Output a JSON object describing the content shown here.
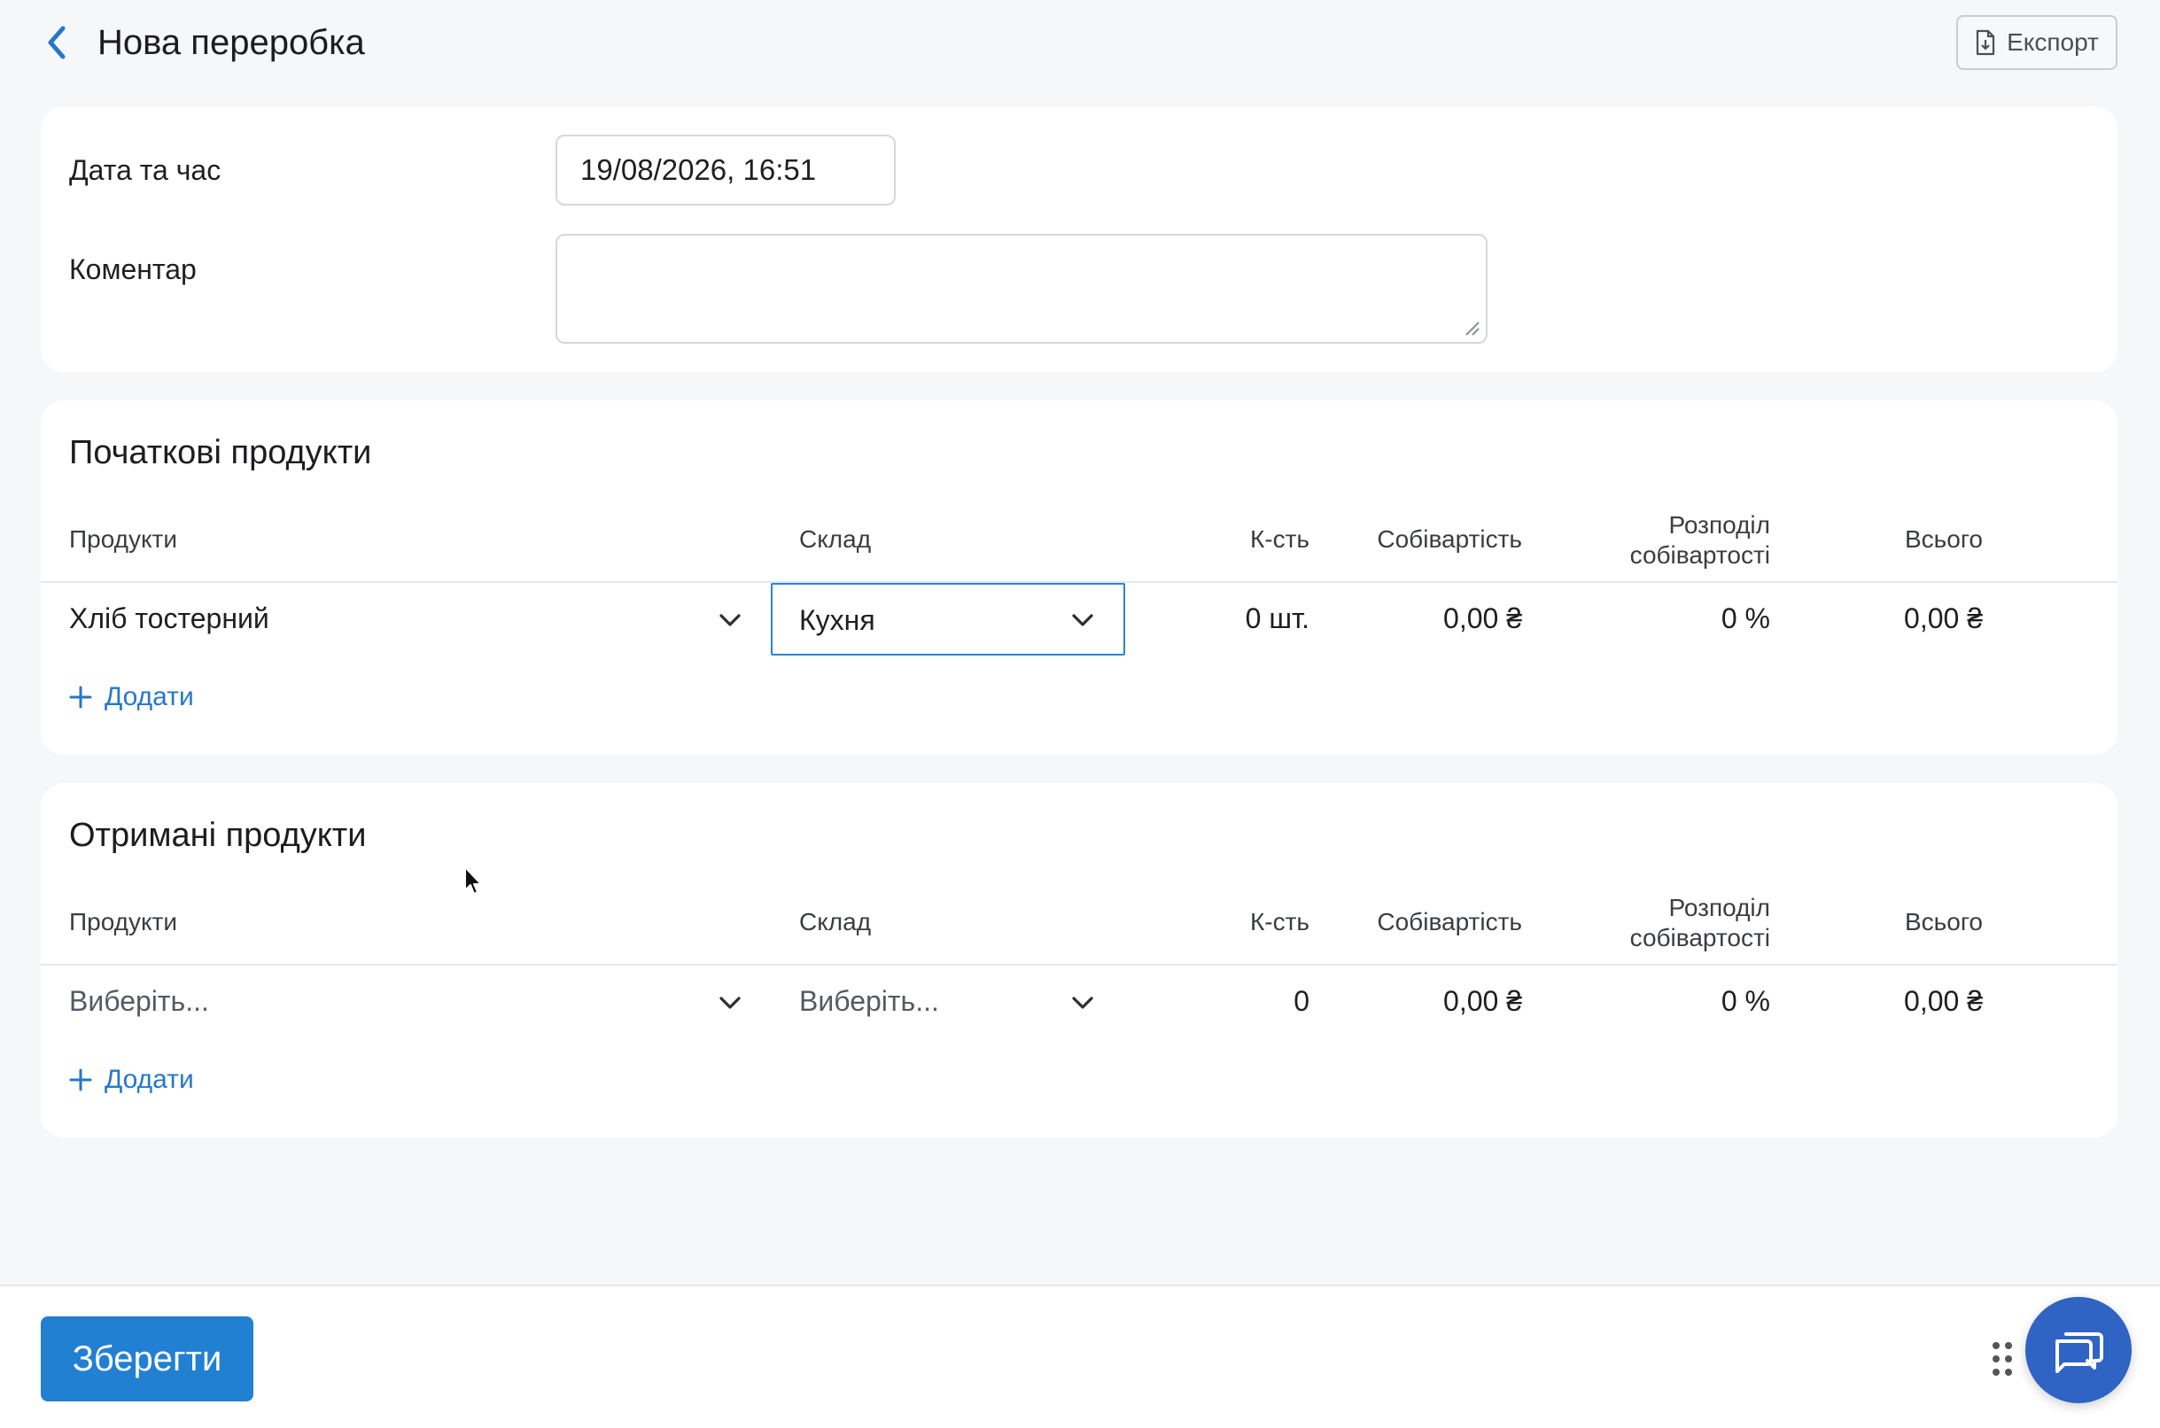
{
  "header": {
    "title": "Нова переробка",
    "export_label": "Експорт"
  },
  "form": {
    "date_label": "Дата та час",
    "date_value": "19/08/2026, 16:51",
    "comment_label": "Коментар",
    "comment_value": ""
  },
  "columns": {
    "products": "Продукти",
    "warehouse": "Склад",
    "qty": "К-сть",
    "cost": "Собівартість",
    "distribution_line1": "Розподіл",
    "distribution_line2": "собівартості",
    "total": "Всього"
  },
  "initial_products": {
    "title": "Початкові продукти",
    "rows": [
      {
        "product": "Хліб тостерний",
        "warehouse": "Кухня",
        "qty": "0 шт.",
        "cost": "0,00 ₴",
        "distribution": "0 %",
        "total": "0,00 ₴"
      }
    ],
    "add_label": "Додати"
  },
  "received_products": {
    "title": "Отримані продукти",
    "rows": [
      {
        "product_placeholder": "Виберіть...",
        "warehouse_placeholder": "Виберіть...",
        "qty": "0",
        "cost": "0,00 ₴",
        "distribution": "0 %",
        "total": "0,00 ₴"
      }
    ],
    "add_label": "Додати"
  },
  "footer": {
    "save_label": "Зберегти"
  },
  "icons": {
    "back": "chevron-left-icon",
    "export": "file-download-icon",
    "dropdown": "chevron-down-icon",
    "add": "plus-icon",
    "drag": "drag-dots-icon",
    "chat": "chat-bubbles-icon"
  },
  "colors": {
    "accent": "#2280d3",
    "link": "#2677c8",
    "chat": "#2f63c4",
    "background": "#f6f7f9"
  }
}
